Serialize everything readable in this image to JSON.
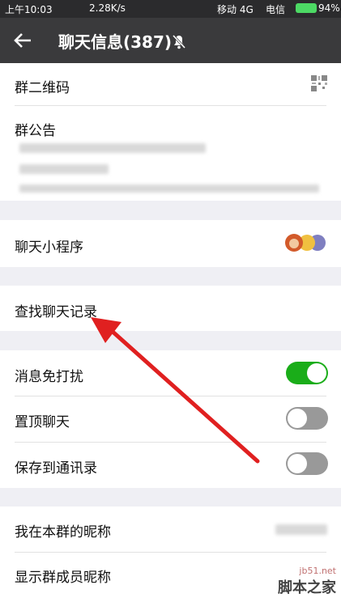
{
  "status_bar": {
    "time": "上午10:03",
    "speed": "2.28K/s",
    "carrier1": "移动 4G",
    "carrier2": "电信",
    "battery": "94%"
  },
  "title_bar": {
    "title": "聊天信息(387)",
    "back_icon": "arrow-left-icon",
    "mute_icon": "bell-off-icon"
  },
  "rows": {
    "qr_label": "群二维码",
    "notice_label": "群公告",
    "mini_program_label": "聊天小程序",
    "search_history_label": "查找聊天记录",
    "mute_label": "消息免打扰",
    "pin_label": "置顶聊天",
    "save_contacts_label": "保存到通讯录",
    "my_nickname_label": "我在本群的昵称",
    "show_nickname_label": "显示群成员昵称"
  },
  "toggles": {
    "mute": true,
    "pin": false,
    "save_contacts": false
  },
  "colors": {
    "toggle_on": "#1aad19",
    "toggle_off": "#999999",
    "arrow": "#e02020"
  },
  "watermark": {
    "site": "jb51.net",
    "brand": "脚本之家"
  }
}
